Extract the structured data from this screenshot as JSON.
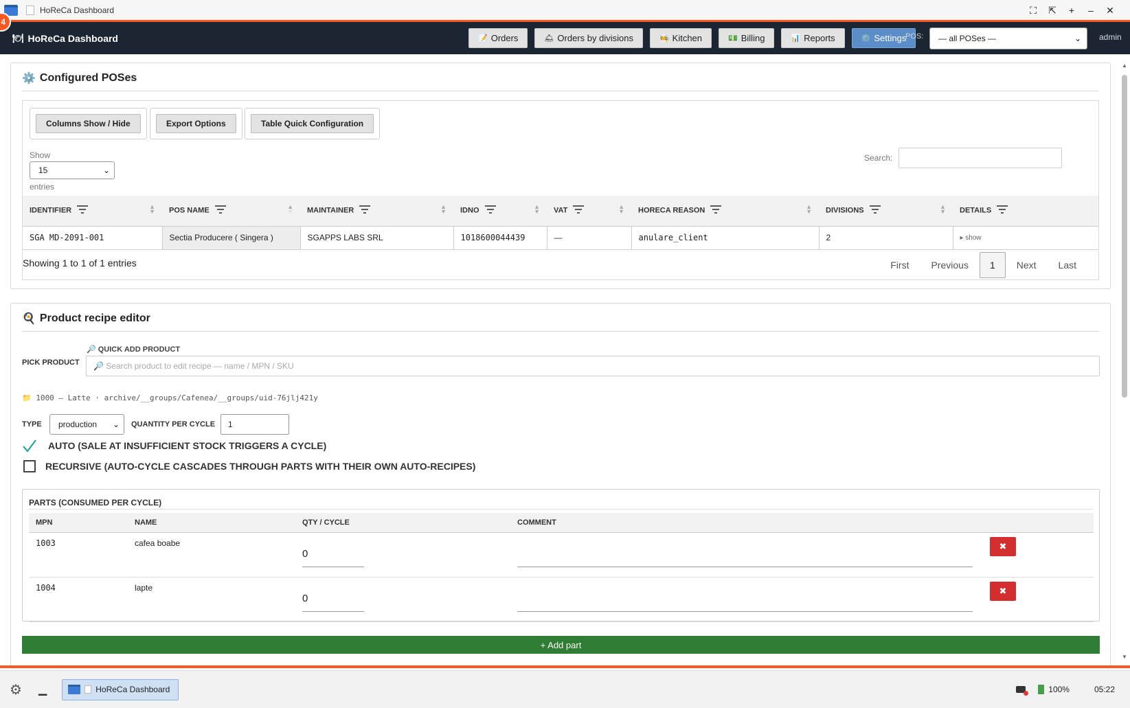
{
  "window": {
    "title": "HoReCa Dashboard",
    "badge": "4",
    "controls": [
      "⛶",
      "⇱",
      "+",
      "–",
      "✕"
    ]
  },
  "appbar": {
    "brand": "HoReCa Dashboard",
    "nav": [
      {
        "label": "Orders",
        "icon": "📝",
        "active": false
      },
      {
        "label": "Orders by divisions",
        "icon": "🛎",
        "active": false
      },
      {
        "label": "Kitchen",
        "icon": "🧑‍🍳",
        "active": false
      },
      {
        "label": "Billing",
        "icon": "💵",
        "active": false
      },
      {
        "label": "Reports",
        "icon": "📊",
        "active": false
      },
      {
        "label": "Settings",
        "icon": "⚙️",
        "active": true
      }
    ],
    "pos_label": "POS:",
    "pos_value": "— all POSes —",
    "user": "admin"
  },
  "poses": {
    "title": "Configured POSes",
    "toolbar": {
      "columns": "Columns Show / Hide",
      "export": "Export Options",
      "quick_config": "Table Quick Configuration"
    },
    "show_label": "Show",
    "page_length": "15",
    "entries_label": "entries",
    "search_label": "Search:",
    "columns": [
      "IDENTIFIER",
      "POS NAME",
      "MAINTAINER",
      "IDNO",
      "VAT",
      "HORECA REASON",
      "DIVISIONS",
      "DETAILS"
    ],
    "rows": [
      {
        "identifier": "SGA MD-2091-001",
        "pos_name": "Sectia Producere ( Singera )",
        "maintainer": "SGAPPS LABS SRL",
        "idno": "1018600044439",
        "vat": "—",
        "horeca_reason": "anulare_client",
        "divisions": "2",
        "details": "▸ show"
      }
    ],
    "info": "Showing 1 to 1 of 1 entries",
    "pager": {
      "first": "First",
      "previous": "Previous",
      "current": "1",
      "next": "Next",
      "last": "Last"
    }
  },
  "recipe": {
    "title": "Product recipe editor",
    "quick_add": "🔎 QUICK ADD PRODUCT",
    "pick_label": "PICK PRODUCT",
    "pick_placeholder": "🔎 Search product to edit recipe — name / MPN / SKU",
    "path": "📁 1000 — Latte · archive/__groups/Cafenea/__groups/uid-76jlj421y",
    "type_label": "TYPE",
    "type_value": "production",
    "qty_label": "QUANTITY PER CYCLE",
    "qty_value": "1",
    "auto_label": "AUTO (SALE AT INSUFFICIENT STOCK TRIGGERS A CYCLE)",
    "auto_checked": true,
    "recursive_label": "RECURSIVE (AUTO-CYCLE CASCADES THROUGH PARTS WITH THEIR OWN AUTO-RECIPES)",
    "recursive_checked": false,
    "parts_title": "PARTS (CONSUMED PER CYCLE)",
    "parts_columns": [
      "MPN",
      "NAME",
      "QTY / CYCLE",
      "COMMENT"
    ],
    "parts": [
      {
        "mpn": "1003",
        "name": "cafea boabe",
        "qty": "0",
        "comment": ""
      },
      {
        "mpn": "1004",
        "name": "lapte",
        "qty": "0",
        "comment": ""
      }
    ],
    "delete_glyph": "✖",
    "add_part": "+ Add part"
  },
  "taskbar": {
    "task_label": "HoReCa Dashboard",
    "battery": "100%",
    "clock": "05:22"
  }
}
